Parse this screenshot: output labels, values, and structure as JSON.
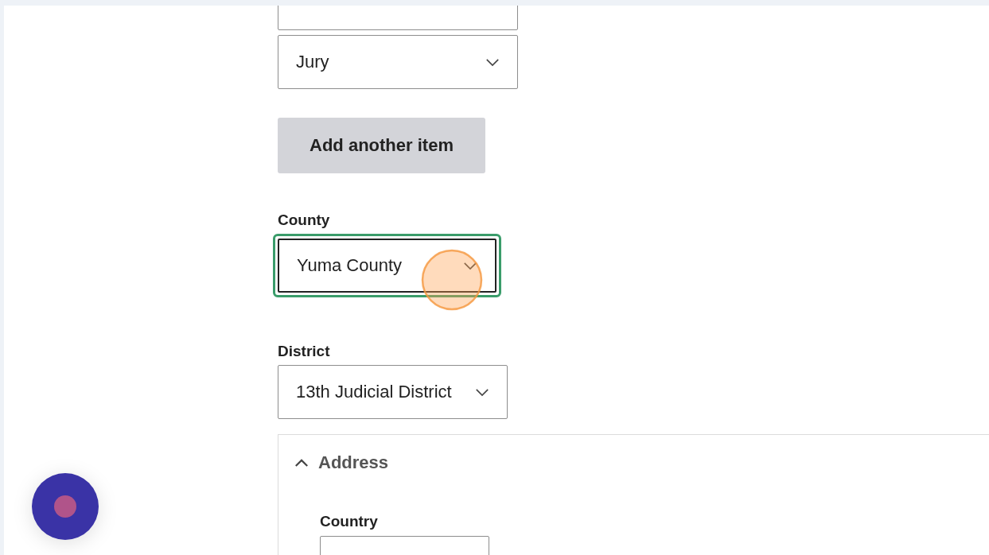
{
  "selects": [
    {
      "focused": false
    },
    {
      "value": "Jury",
      "focused": false
    }
  ],
  "add_button": {
    "label": "Add another item"
  },
  "fields": [
    {
      "label": "County",
      "value": "Yuma County",
      "focused": true
    },
    {
      "label": "District",
      "value": "13th Judicial District",
      "focused": false
    }
  ],
  "address": {
    "title": "Address",
    "expanded": true,
    "country_label": "Country"
  }
}
